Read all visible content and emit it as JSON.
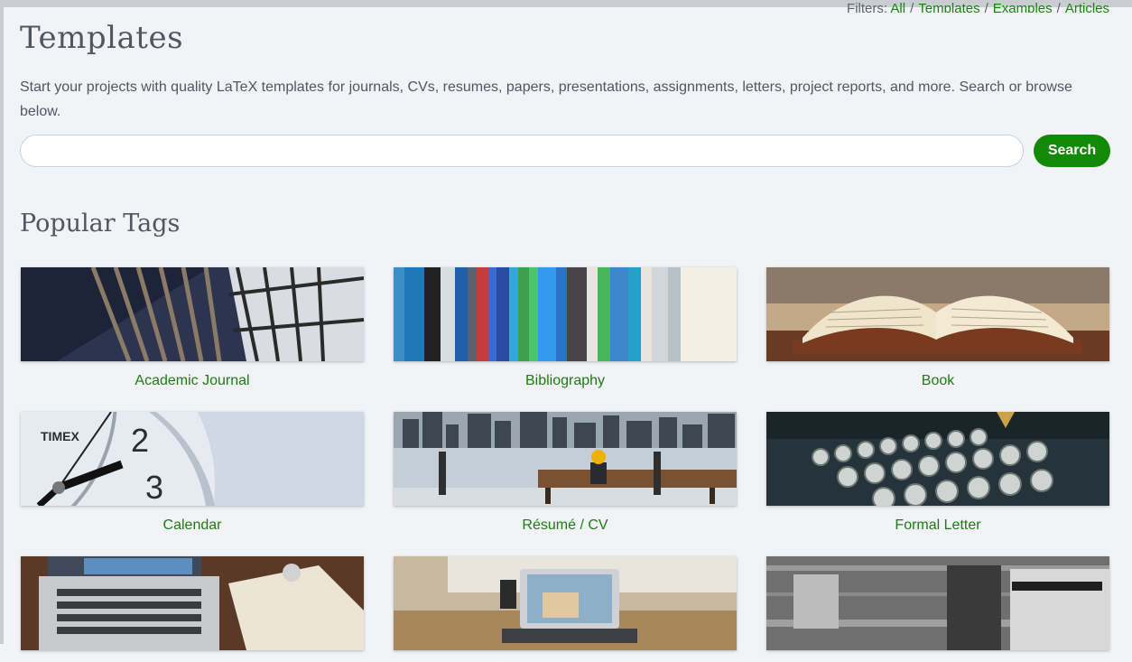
{
  "header": {
    "filters_prefix": "Filters:",
    "filters": [
      "All",
      "Templates",
      "Examples",
      "Articles"
    ],
    "filter_separator": "/"
  },
  "page_title": "Templates",
  "intro_text": "Start your projects with quality LaTeX templates for journals, CVs, resumes, papers, presentations, assignments, letters, project reports, and more. Search or browse below.",
  "search": {
    "placeholder": "",
    "value": "",
    "button_label": "Search"
  },
  "popular_tags_title": "Popular Tags",
  "tags": [
    {
      "label": "Academic Journal",
      "image": "library-shelves-image"
    },
    {
      "label": "Bibliography",
      "image": "book-spines-image"
    },
    {
      "label": "Book",
      "image": "open-book-image"
    },
    {
      "label": "Calendar",
      "image": "clock-image"
    },
    {
      "label": "Résumé / CV",
      "image": "bench-skyline-image"
    },
    {
      "label": "Formal Letter",
      "image": "typewriter-image"
    },
    {
      "label": "",
      "image": "laptop-desk-image"
    },
    {
      "label": "",
      "image": "laptop-window-image"
    },
    {
      "label": "",
      "image": "magazine-blur-image"
    }
  ],
  "colors": {
    "accent_green": "#138a07",
    "link_green": "#1d7d11",
    "text_gray": "#505763",
    "background": "#f1f3f7"
  }
}
